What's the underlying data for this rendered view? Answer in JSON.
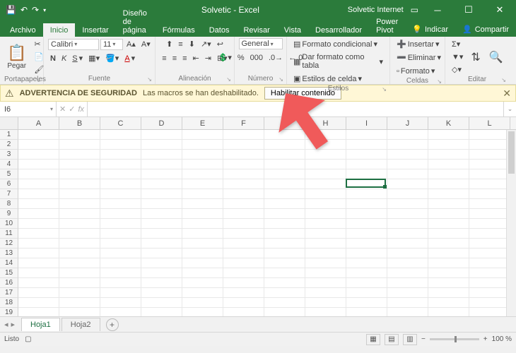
{
  "title": "Solvetic - Excel",
  "user": "Solvetic Internet",
  "tabs": {
    "file": "Archivo",
    "home": "Inicio",
    "insert": "Insertar",
    "page": "Diseño de página",
    "formulas": "Fórmulas",
    "data": "Datos",
    "review": "Revisar",
    "view": "Vista",
    "developer": "Desarrollador",
    "powerpivot": "Power Pivot",
    "tell": "Indicar",
    "share": "Compartir"
  },
  "ribbon": {
    "paste": "Pegar",
    "font_name": "Calibri",
    "font_size": "11",
    "numfmt": "General",
    "cond": "Formato condicional",
    "table": "Dar formato como tabla",
    "styles": "Estilos de celda",
    "insertc": "Insertar",
    "deletec": "Eliminar",
    "formatc": "Formato",
    "g_clip": "Portapapeles",
    "g_font": "Fuente",
    "g_align": "Alineación",
    "g_num": "Número",
    "g_styles": "Estilos",
    "g_cells": "Celdas",
    "g_edit": "Editar"
  },
  "warning": {
    "title": "ADVERTENCIA DE SEGURIDAD",
    "msg": "Las macros se han deshabilitado.",
    "btn": "Habilitar contenido"
  },
  "namebox": "I6",
  "columns": [
    "A",
    "B",
    "C",
    "D",
    "E",
    "F",
    "G",
    "H",
    "I",
    "J",
    "K",
    "L"
  ],
  "rows": [
    "1",
    "2",
    "3",
    "4",
    "5",
    "6",
    "7",
    "8",
    "9",
    "10",
    "11",
    "12",
    "13",
    "14",
    "15",
    "16",
    "17",
    "18",
    "19"
  ],
  "active_cell": {
    "col": 8,
    "row": 5
  },
  "sheets": {
    "s1": "Hoja1",
    "s2": "Hoja2"
  },
  "status": {
    "ready": "Listo",
    "zoom": "100 %"
  }
}
